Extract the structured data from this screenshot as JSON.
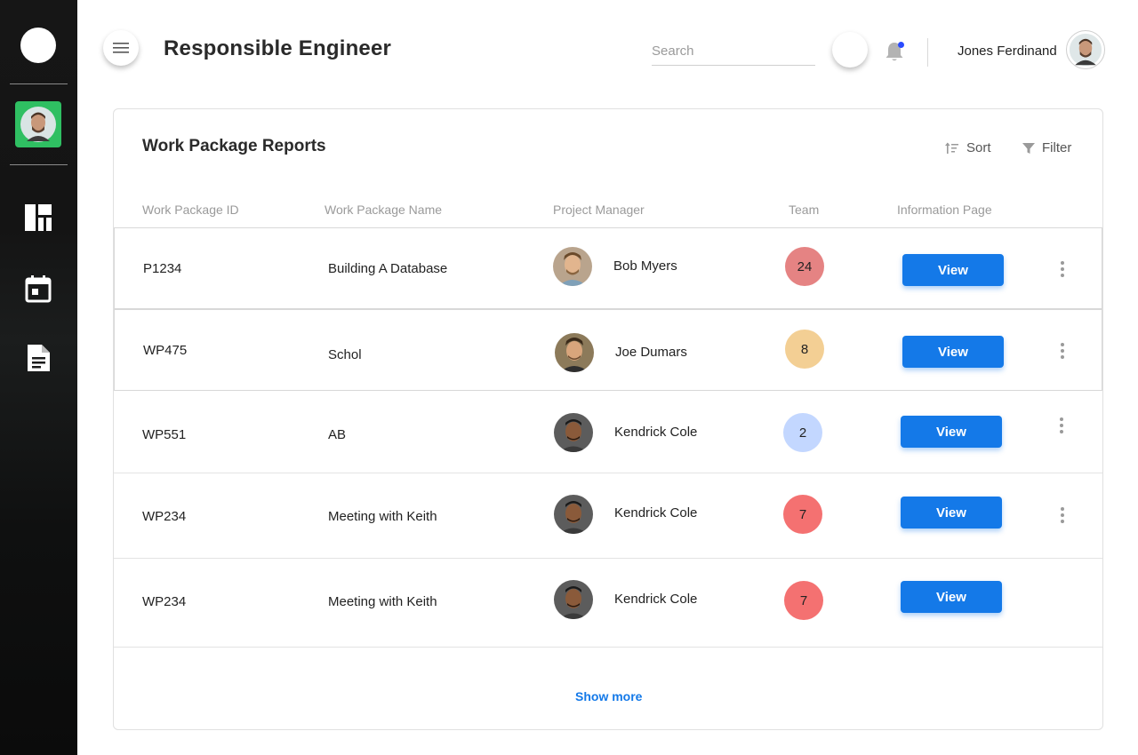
{
  "header": {
    "title": "Responsible Engineer",
    "search_placeholder": "Search",
    "user_name": "Jones Ferdinand"
  },
  "sidebar": {
    "items": [
      {
        "icon": "dashboard-icon"
      },
      {
        "icon": "calendar-icon"
      },
      {
        "icon": "document-icon"
      }
    ]
  },
  "card": {
    "title": "Work Package Reports",
    "sort_label": "Sort",
    "filter_label": "Filter",
    "columns": [
      "Work Package ID",
      "Work Package Name",
      "Project Manager",
      "Team",
      "Information Page"
    ],
    "rows": [
      {
        "id": "P1234",
        "name": "Building A Database",
        "manager": "Bob Myers",
        "team": "24",
        "team_color": "#e58383",
        "button": "View"
      },
      {
        "id": "WP475",
        "name": "Schol",
        "manager": "Joe Dumars",
        "team": "8",
        "team_color": "#f3cf94",
        "button": "View"
      },
      {
        "id": "WP551",
        "name": "AB",
        "manager": "Kendrick Cole",
        "team": "2",
        "team_color": "#c3d7ff",
        "button": "View"
      },
      {
        "id": "WP234",
        "name": "Meeting with Keith",
        "manager": "Kendrick Cole",
        "team": "7",
        "team_color": "#f47171",
        "button": "View"
      },
      {
        "id": "WP234",
        "name": "Meeting with Keith",
        "manager": "Kendrick Cole",
        "team": "7",
        "team_color": "#f47171",
        "button": "View"
      }
    ],
    "show_more": "Show more"
  },
  "colors": {
    "accent": "#1479e8",
    "sidebar_avatar_bg": "#2fbf62",
    "notification_dot": "#2a4bff"
  }
}
